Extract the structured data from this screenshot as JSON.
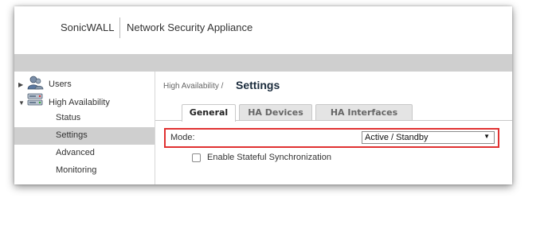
{
  "header": {
    "brand": "SonicWALL",
    "product": "Network Security Appliance"
  },
  "sidebar": {
    "users_label": "Users",
    "ha_label": "High Availability",
    "sub_items": [
      "Status",
      "Settings",
      "Advanced",
      "Monitoring"
    ],
    "selected_item": "Settings"
  },
  "main": {
    "breadcrumb": "High Availability /",
    "page_title": "Settings",
    "tabs": [
      "General",
      "HA Devices",
      "HA Interfaces"
    ],
    "active_tab": "General",
    "mode_label": "Mode:",
    "mode_value": "Active / Standby",
    "stateful_sync_label": "Enable Stateful Synchronization",
    "stateful_sync_checked": false
  },
  "colors": {
    "highlight": "#e03131",
    "selected_row": "#cfcfcf",
    "grey_bar": "#cfcfcf"
  },
  "icons": [
    "users-icon",
    "high-availability-icon",
    "caret-right-icon",
    "caret-down-icon",
    "dropdown-arrow-icon"
  ]
}
